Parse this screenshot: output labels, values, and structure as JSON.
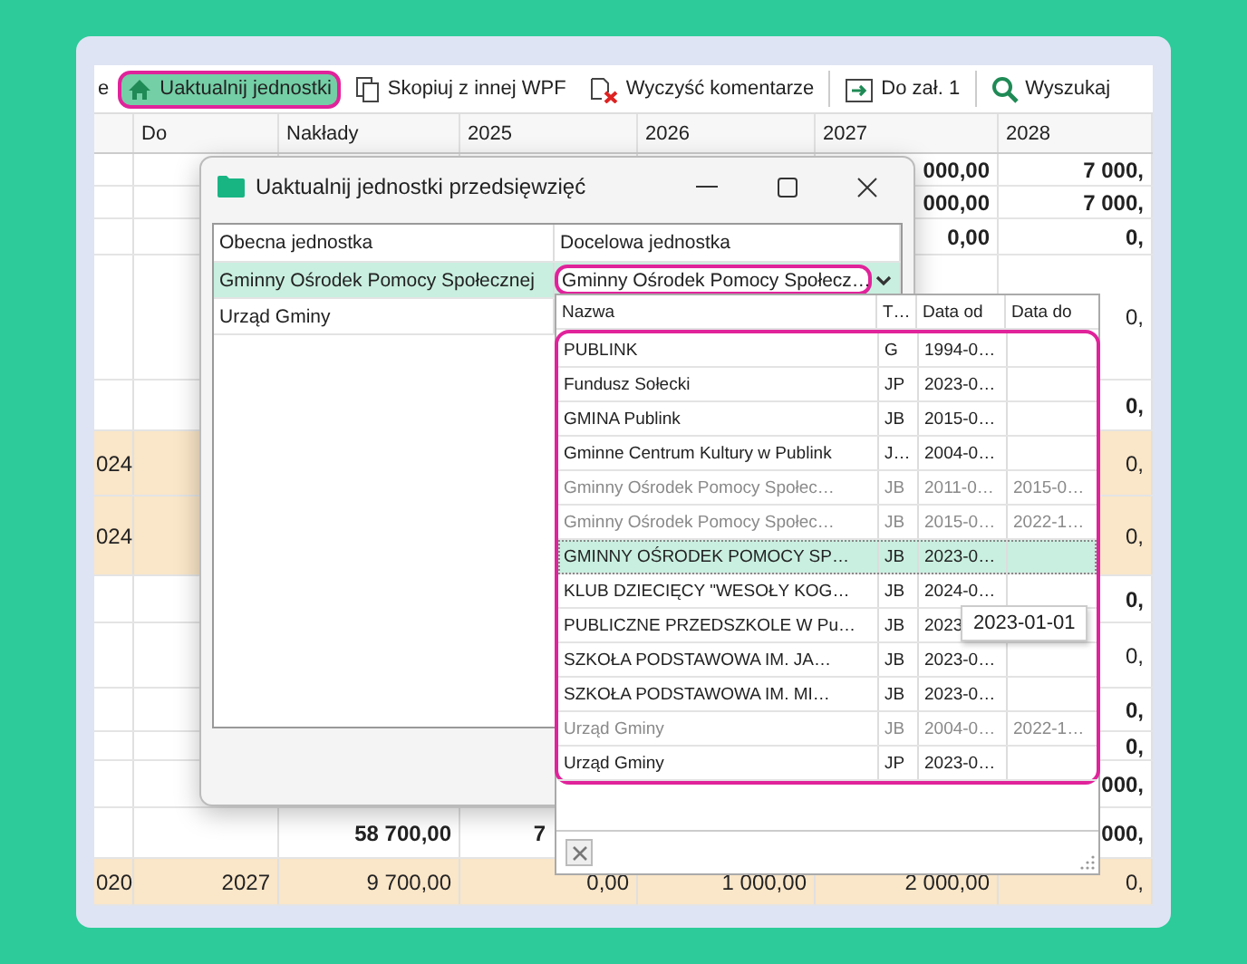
{
  "toolbar": {
    "items": [
      {
        "label": "e",
        "kind": "none",
        "selected": false,
        "separator_before": false
      },
      {
        "label": "Uaktualnij jednostki",
        "kind": "home",
        "selected": true,
        "separator_before": false
      },
      {
        "label": "Skopiuj z innej WPF",
        "kind": "copy",
        "selected": false,
        "separator_before": false
      },
      {
        "label": "Wyczyść komentarze",
        "kind": "clear",
        "selected": false,
        "separator_before": false
      },
      {
        "label": "Do zał. 1",
        "kind": "export",
        "selected": false,
        "separator_before": true
      },
      {
        "label": "Wyszukaj",
        "kind": "search",
        "selected": false,
        "separator_before": true
      }
    ]
  },
  "grid": {
    "columns": [
      "Do",
      "Nakłady",
      "2025",
      "2026",
      "2027",
      "2028"
    ],
    "rows": [
      {
        "highlighted": false,
        "bold": true,
        "cells": {
          "y2027": "000,00",
          "y2028": "7 000,"
        }
      },
      {
        "highlighted": false,
        "bold": true,
        "cells": {
          "y2027": "000,00",
          "y2028": "7 000,"
        }
      },
      {
        "highlighted": false,
        "bold": true,
        "cells": {
          "y2027": "0,00",
          "y2028": "0,"
        }
      },
      {
        "highlighted": false,
        "bold": false,
        "cells": {
          "y2028": "0,"
        }
      },
      {
        "highlighted": false,
        "bold": true,
        "cells": {
          "y2028": "0,"
        }
      },
      {
        "highlighted": true,
        "bold": false,
        "cells": {
          "column_1": "024",
          "y2028": "0,"
        }
      },
      {
        "highlighted": true,
        "bold": false,
        "cells": {
          "column_1": "024",
          "y2028": "0,"
        }
      },
      {
        "highlighted": false,
        "bold": true,
        "cells": {
          "y2028": "0,"
        }
      },
      {
        "highlighted": false,
        "bold": false,
        "cells": {
          "y2028": "0,"
        }
      },
      {
        "highlighted": false,
        "bold": true,
        "cells": {
          "y2028": "0,"
        }
      },
      {
        "highlighted": false,
        "bold": true,
        "cells": {
          "y2028": "0,"
        }
      },
      {
        "highlighted": false,
        "bold": true,
        "cells": {
          "y2028": "000,"
        }
      },
      {
        "highlighted": false,
        "bold": true,
        "cells": {
          "naklady": "58 700,00",
          "y2025": "7",
          "y2028": "000,"
        }
      },
      {
        "highlighted": true,
        "bold": false,
        "cells": {
          "column_1": "020",
          "do": "2027",
          "naklady": "9 700,00",
          "y2025": "0,00",
          "y2026": "1 000,00",
          "y2027": "2 000,00",
          "y2028": "0,"
        }
      }
    ]
  },
  "dialog": {
    "title": "Uaktualnij jednostki przedsięwzięć",
    "columns": [
      "Obecna jednostka",
      "Docelowa jednostka"
    ],
    "rows": [
      {
        "current": "Gminny Ośrodek Pomocy Społecznej",
        "target": "Gminny Ośrodek Pomocy Społecz…",
        "selected": true
      },
      {
        "current": "Urząd Gminy",
        "selected": false
      }
    ]
  },
  "dropdown": {
    "outlined": true,
    "columns": [
      "Nazwa",
      "T…",
      "Data od",
      "Data do"
    ],
    "rows": [
      {
        "name": "PUBLINK",
        "type": "G",
        "from": "1994-0…",
        "disabled": false,
        "selected": false
      },
      {
        "name": "Fundusz Sołecki",
        "type": "JP",
        "from": "2023-0…",
        "disabled": false,
        "selected": false
      },
      {
        "name": "GMINA Publink",
        "type": "JB",
        "from": "2015-0…",
        "disabled": false,
        "selected": false
      },
      {
        "name": "Gminne Centrum Kultury w Publink",
        "type": "J…",
        "from": "2004-0…",
        "disabled": false,
        "selected": false
      },
      {
        "name": "Gminny Ośrodek Pomocy Społec…",
        "type": "JB",
        "from": "2011-0…",
        "to": "2015-0…",
        "disabled": true,
        "selected": false
      },
      {
        "name": "Gminny Ośrodek Pomocy Społec…",
        "type": "JB",
        "from": "2015-0…",
        "to": "2022-1…",
        "disabled": true,
        "selected": false
      },
      {
        "name": "GMINNY OŚRODEK POMOCY SP…",
        "type": "JB",
        "from": "2023-0…",
        "disabled": false,
        "selected": true
      },
      {
        "name": "KLUB DZIECIĘCY \"WESOŁY KOG…",
        "type": "JB",
        "from": "2024-0…",
        "disabled": false,
        "selected": false
      },
      {
        "name": "PUBLICZNE PRZEDSZKOLE W Pu…",
        "type": "JB",
        "from": "2023",
        "disabled": false,
        "selected": false
      },
      {
        "name": "SZKOŁA PODSTAWOWA IM. JA…",
        "type": "JB",
        "from": "2023-0…",
        "disabled": false,
        "selected": false
      },
      {
        "name": "SZKOŁA PODSTAWOWA IM. MI…",
        "type": "JB",
        "from": "2023-0…",
        "disabled": false,
        "selected": false
      },
      {
        "name": "Urząd Gminy",
        "type": "JB",
        "from": "2004-0…",
        "to": "2022-1…",
        "disabled": true,
        "selected": false
      },
      {
        "name": "Urząd Gminy",
        "type": "JP",
        "from": "2023-0…",
        "disabled": false,
        "selected": false
      }
    ],
    "tooltip": "2023-01-01"
  }
}
